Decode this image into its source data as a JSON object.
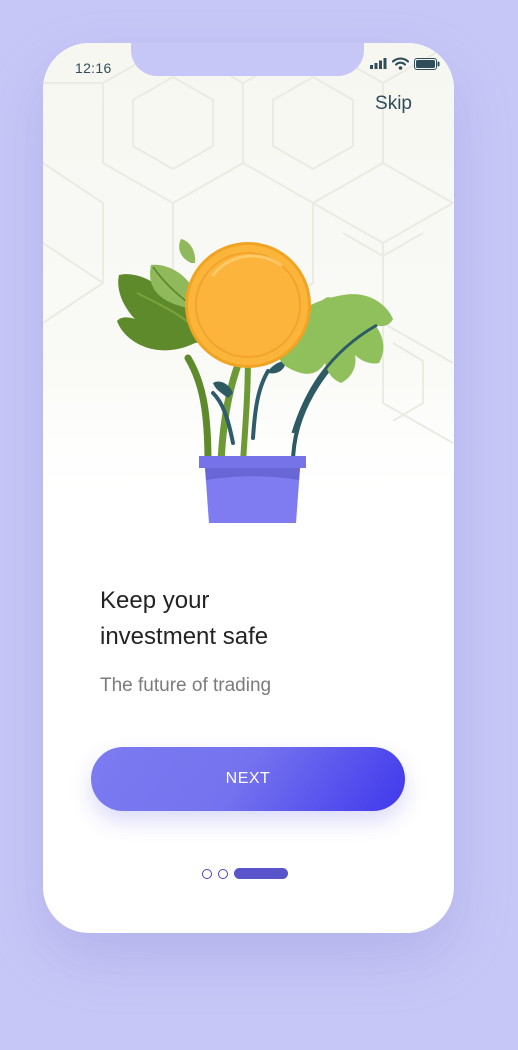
{
  "status_bar": {
    "time": "12:16",
    "icons": [
      "signal-icon",
      "wifi-icon",
      "battery-icon"
    ]
  },
  "header": {
    "skip_label": "Skip"
  },
  "illustration": {
    "subject": "money-plant-icon"
  },
  "content": {
    "headline_line1": "Keep your",
    "headline_line2": "investment safe",
    "subtitle": "The future of trading"
  },
  "actions": {
    "next_label": "NEXT"
  },
  "pager": {
    "total_pages": 3,
    "current_page": 3
  },
  "colors": {
    "background": "#c7c7f7",
    "accent": "#5954c9",
    "button_start": "#7d7bf1",
    "button_end": "#3f38ed",
    "coin": "#fcb53b",
    "pot": "#7f7cf2"
  }
}
